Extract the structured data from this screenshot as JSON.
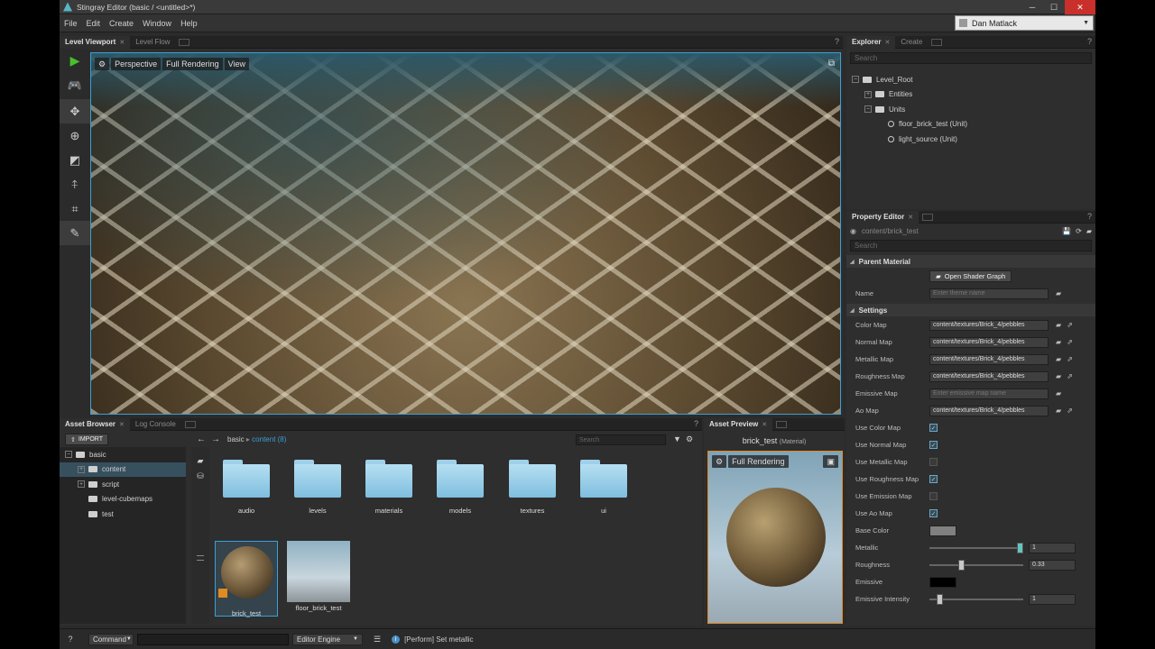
{
  "window": {
    "title": "Stingray Editor (basic / <untitled>*)",
    "user_name": "Dan Matlack"
  },
  "menu": [
    "File",
    "Edit",
    "Create",
    "Window",
    "Help"
  ],
  "viewport_panel": {
    "tabs": [
      {
        "label": "Level Viewport"
      },
      {
        "label": "Level Flow"
      }
    ],
    "toolbar": {
      "perspective": "Perspective",
      "rendering": "Full Rendering",
      "view": "View"
    }
  },
  "explorer": {
    "tabs": [
      {
        "label": "Explorer"
      },
      {
        "label": "Create"
      }
    ],
    "search_placeholder": "Search",
    "tree": [
      {
        "label": "Level_Root",
        "depth": 0
      },
      {
        "label": "Entities",
        "depth": 1
      },
      {
        "label": "Units",
        "depth": 1
      },
      {
        "label": "floor_brick_test (Unit)",
        "depth": 2
      },
      {
        "label": "light_source (Unit)",
        "depth": 2
      }
    ]
  },
  "property_editor": {
    "tab": "Property Editor",
    "path": "content/brick_test",
    "search_placeholder": "Search",
    "parent_material": {
      "section": "Parent Material",
      "button": "Open Shader Graph",
      "name_label": "Name",
      "name_placeholder": "Enter theme name"
    },
    "settings": {
      "section": "Settings",
      "maps": [
        {
          "label": "Color Map",
          "value": "content/textures/Brick_4/pebbles"
        },
        {
          "label": "Normal Map",
          "value": "content/textures/Brick_4/pebbles"
        },
        {
          "label": "Metallic Map",
          "value": "content/textures/Brick_4/pebbles"
        },
        {
          "label": "Roughness Map",
          "value": "content/textures/Brick_4/pebbles"
        },
        {
          "label": "Emissive Map",
          "value": "",
          "placeholder": "Enter emissive map name"
        },
        {
          "label": "Ao Map",
          "value": "content/textures/Brick_4/pebbles"
        }
      ],
      "toggles": [
        {
          "label": "Use Color Map",
          "checked": true
        },
        {
          "label": "Use Normal Map",
          "checked": true
        },
        {
          "label": "Use Metallic Map",
          "checked": false
        },
        {
          "label": "Use Roughness Map",
          "checked": true
        },
        {
          "label": "Use Emission Map",
          "checked": false
        },
        {
          "label": "Use Ao Map",
          "checked": true
        }
      ],
      "base_color": {
        "label": "Base Color",
        "color": "#808080"
      },
      "metallic": {
        "label": "Metallic",
        "value": "1",
        "fraction": 1.0
      },
      "roughness": {
        "label": "Roughness",
        "value": "0.33",
        "fraction": 0.33
      },
      "emissive": {
        "label": "Emissive",
        "color": "#000000"
      },
      "emissive_intensity": {
        "label": "Emissive Intensity",
        "value": "1",
        "fraction": 0.1
      }
    }
  },
  "asset_browser": {
    "tabs": [
      {
        "label": "Asset Browser"
      },
      {
        "label": "Log Console"
      }
    ],
    "import_label": "IMPORT",
    "breadcrumb": {
      "root": "basic",
      "current": "content (8)"
    },
    "search_placeholder": "Search",
    "tree": [
      {
        "label": "basic",
        "depth": 0
      },
      {
        "label": "content",
        "depth": 1
      },
      {
        "label": "script",
        "depth": 1
      },
      {
        "label": "level-cubemaps",
        "depth": 2
      },
      {
        "label": "test",
        "depth": 2
      }
    ],
    "folders": [
      "audio",
      "levels",
      "materials",
      "models",
      "textures",
      "ui"
    ],
    "assets": [
      "brick_test",
      "floor_brick_test"
    ]
  },
  "asset_preview": {
    "tab": "Asset Preview",
    "title": "brick_test",
    "title_suffix": "(Material)",
    "rendering": "Full Rendering"
  },
  "status": {
    "help": "?",
    "command_label": "Command",
    "engine_label": "Editor Engine",
    "message": "[Perform] Set metallic"
  },
  "colors": {
    "accent": "#3aa0d6",
    "selection": "#e08a20",
    "play": "#49c02b"
  }
}
